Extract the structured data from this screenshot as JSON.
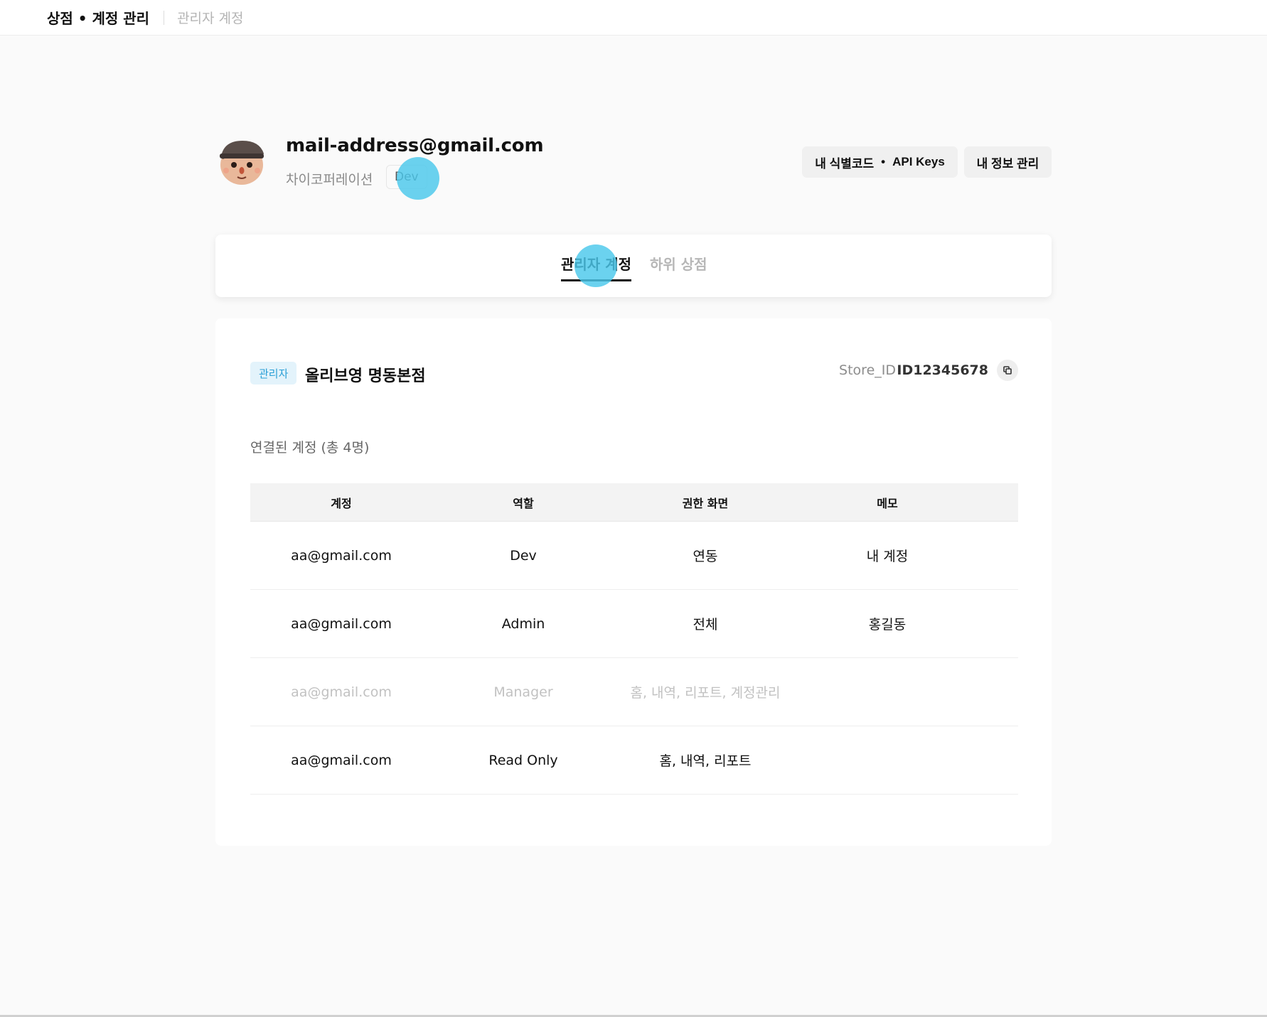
{
  "topbar": {
    "title": "상점 • 계정 관리",
    "current": "관리자 계정"
  },
  "profile": {
    "email": "mail-address@gmail.com",
    "company": "차이코퍼레이션",
    "role": "Dev",
    "buttons": {
      "id_code": "내 식별코드",
      "dot": "•",
      "api_keys": "API Keys",
      "my_info": "내 정보 관리"
    }
  },
  "tabs": [
    {
      "label": "관리자 계정",
      "active": true
    },
    {
      "label": "하위 상점",
      "active": false
    }
  ],
  "store": {
    "badge": "관리자",
    "name": "올리브영 명동본점",
    "id_label": "Store_ID",
    "id_value": "ID12345678"
  },
  "accounts": {
    "title": "연결된 계정 (총 4명)",
    "columns": [
      "계정",
      "역할",
      "권한 화면",
      "메모"
    ],
    "rows": [
      {
        "account": "aa@gmail.com",
        "role": "Dev",
        "screens": "연동",
        "memo": "내 계정",
        "disabled": false
      },
      {
        "account": "aa@gmail.com",
        "role": "Admin",
        "screens": "전체",
        "memo": "홍길동",
        "disabled": false
      },
      {
        "account": "aa@gmail.com",
        "role": "Manager",
        "screens": "홈, 내역, 리포트, 계정관리",
        "memo": "",
        "disabled": true
      },
      {
        "account": "aa@gmail.com",
        "role": "Read Only",
        "screens": "홈, 내역, 리포트",
        "memo": "",
        "disabled": false
      }
    ]
  },
  "colors": {
    "accent": "#2a9fd6",
    "badge_bg": "#e3f3fb",
    "touch_indicator": "#4ac8eb"
  }
}
